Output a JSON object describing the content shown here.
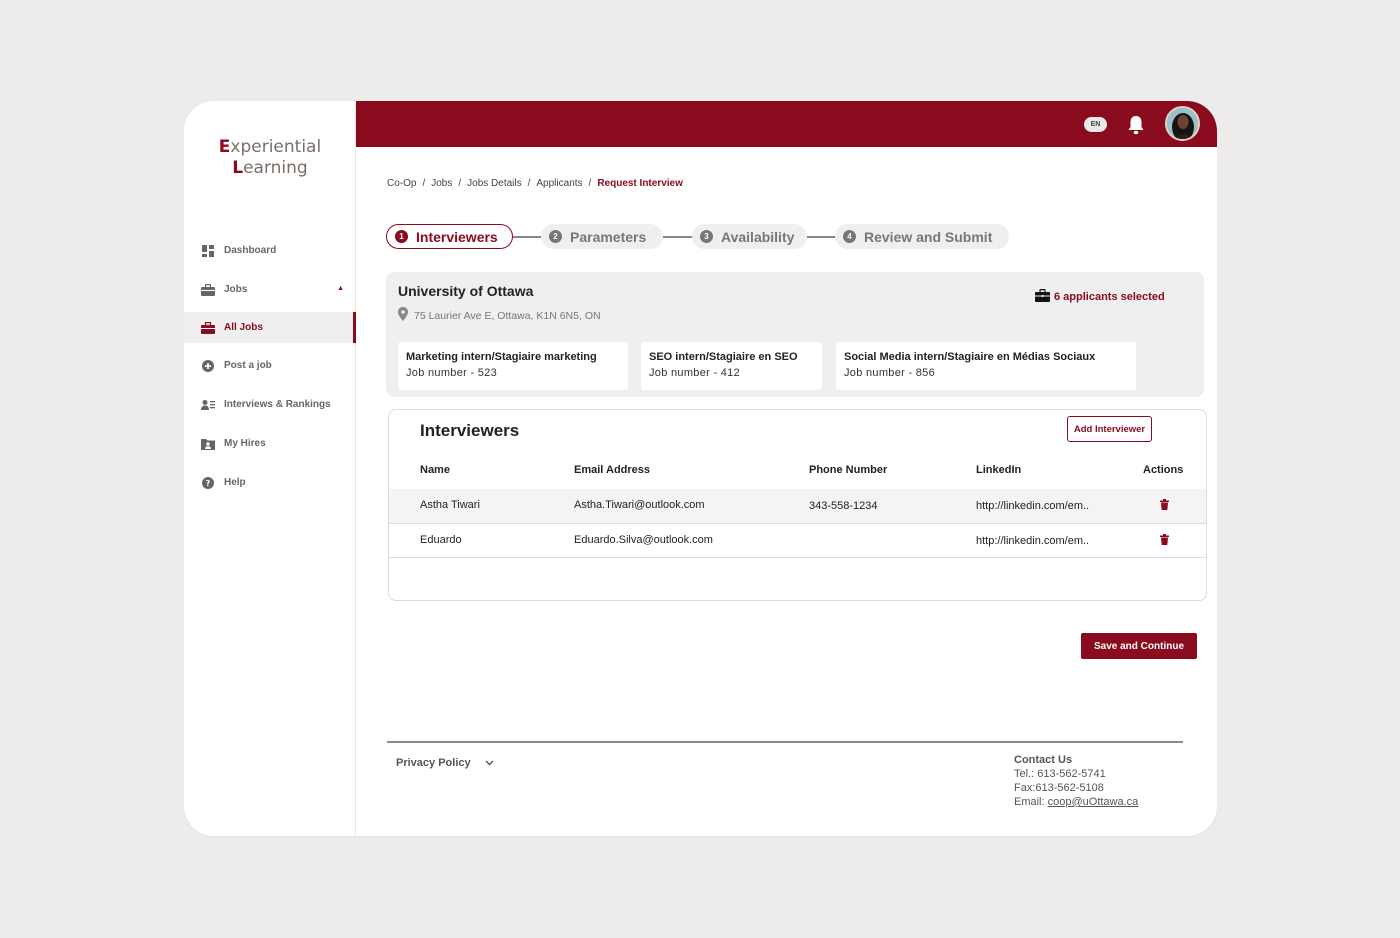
{
  "brand": {
    "first_cap": "E",
    "first_rest": "xperiential",
    "second_cap": "L",
    "second_rest": "earning"
  },
  "colors": {
    "accent": "#8a0b1e",
    "panel": "#efefef"
  },
  "sidebar": {
    "items": [
      {
        "label": "Dashboard",
        "icon": "dashboard-icon"
      },
      {
        "label": "Jobs",
        "icon": "briefcase-icon"
      },
      {
        "label": "All Jobs",
        "icon": "briefcase-icon",
        "active": true
      },
      {
        "label": "Post a job",
        "icon": "plus-circle-icon"
      },
      {
        "label": "Interviews & Rankings",
        "icon": "person-list-icon"
      },
      {
        "label": "My Hires",
        "icon": "person-folder-icon"
      },
      {
        "label": "Help",
        "icon": "help-icon"
      }
    ]
  },
  "topbar": {
    "language": "EN"
  },
  "breadcrumb": [
    "Co-Op",
    "Jobs",
    "Jobs Details",
    "Applicants",
    "Request Interview"
  ],
  "stepper": [
    {
      "num": "1",
      "label": "Interviewers"
    },
    {
      "num": "2",
      "label": "Parameters"
    },
    {
      "num": "3",
      "label": "Availability"
    },
    {
      "num": "4",
      "label": "Review and Submit"
    }
  ],
  "university": {
    "name": "University of Ottawa",
    "address": "75 Laurier Ave E, Ottawa, K1N 6N5, ON",
    "selected": "6 applicants selected",
    "jobs": [
      {
        "title": "Marketing intern/Stagiaire marketing",
        "number": "Job number - 523"
      },
      {
        "title": "SEO intern/Stagiaire en SEO",
        "number": "Job number - 412"
      },
      {
        "title": "Social Media intern/Stagiaire en Médias Sociaux",
        "number": "Job number - 856"
      }
    ]
  },
  "interviewers": {
    "title": "Interviewers",
    "add_label": "Add Interviewer",
    "headers": [
      "Name",
      "Email Address",
      "Phone Number",
      "LinkedIn",
      "Actions"
    ],
    "rows": [
      {
        "name": "Astha Tiwari",
        "email": "Astha.Tiwari@outlook.com",
        "phone": "343-558-1234",
        "linkedin": "http://linkedin.com/em.."
      },
      {
        "name": "Eduardo",
        "email": "Eduardo.Silva@outlook.com",
        "phone": "",
        "linkedin": "http://linkedin.com/em.."
      }
    ]
  },
  "save_label": "Save and Continue",
  "footer": {
    "privacy": "Privacy Policy",
    "contact_title": "Contact Us",
    "tel": "Tel.: 613-562-5741",
    "fax": "Fax:613-562-5108",
    "email_label": "Email: ",
    "email": "coop@uOttawa.ca"
  }
}
